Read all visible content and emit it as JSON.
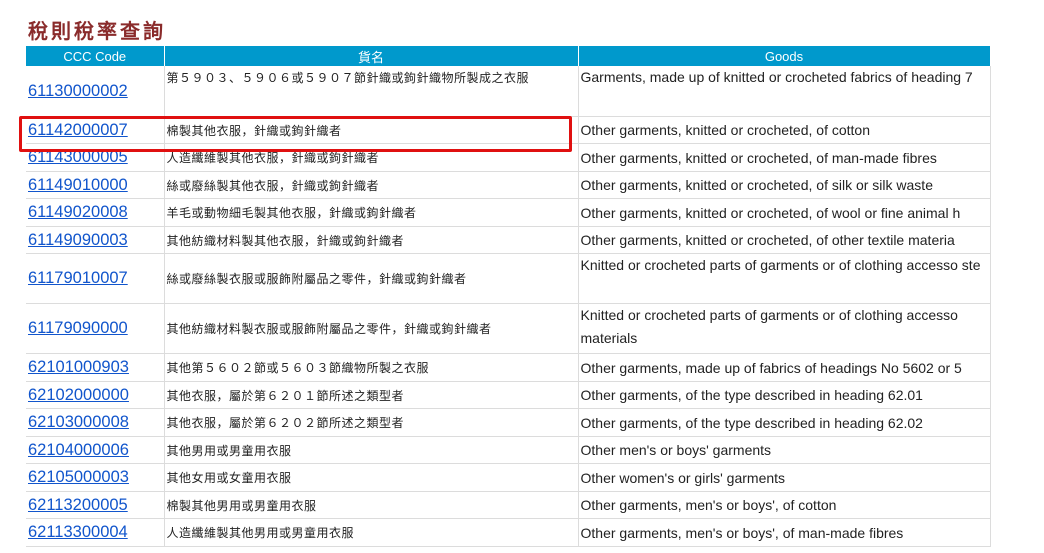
{
  "page": {
    "title": "稅則稅率查詢"
  },
  "table": {
    "headers": {
      "code": "CCC Code",
      "zh": "貨名",
      "en": "Goods"
    },
    "rows": [
      {
        "code": "61130000002",
        "zh": "第５９０３、５９０６或５９０７節針織或鉤針織物所製成之衣服",
        "en": "Garments, made up of knitted or crocheted fabrics of heading 7"
      },
      {
        "code": "61142000007",
        "zh": "棉製其他衣服，針織或鉤針織者",
        "en": "Other garments, knitted or crocheted, of cotton"
      },
      {
        "code": "61143000005",
        "zh": "人造纖維製其他衣服，針織或鉤針織者",
        "en": "Other garments, knitted or crocheted, of man-made fibres"
      },
      {
        "code": "61149010000",
        "zh": "絲或廢絲製其他衣服，針織或鉤針織者",
        "en": "Other garments, knitted or crocheted, of silk or silk waste"
      },
      {
        "code": "61149020008",
        "zh": "羊毛或動物細毛製其他衣服，針織或鉤針織者",
        "en": "Other garments, knitted or crocheted, of wool or fine animal h"
      },
      {
        "code": "61149090003",
        "zh": "其他紡織材料製其他衣服，針織或鉤針織者",
        "en": "Other garments, knitted or crocheted, of other textile materia"
      },
      {
        "code": "61179010007",
        "zh": "絲或廢絲製衣服或服飾附屬品之零件，針織或鉤針織者",
        "en": "Knitted or crocheted parts of garments or of clothing accesso ste"
      },
      {
        "code": "61179090000",
        "zh": "其他紡織材料製衣服或服飾附屬品之零件，針織或鉤針織者",
        "en": "Knitted or crocheted parts of garments or of clothing accesso materials"
      },
      {
        "code": "62101000903",
        "zh": "其他第５６０２節或５６０３節織物所製之衣服",
        "en": "Other garments, made up of fabrics of headings No 5602 or 5"
      },
      {
        "code": "62102000000",
        "zh": "其他衣服，屬於第６２０１節所述之類型者",
        "en": "Other garments, of the type described in heading 62.01"
      },
      {
        "code": "62103000008",
        "zh": "其他衣服，屬於第６２０２節所述之類型者",
        "en": "Other garments, of the type described in heading 62.02"
      },
      {
        "code": "62104000006",
        "zh": "其他男用或男童用衣服",
        "en": "Other men's or boys' garments"
      },
      {
        "code": "62105000003",
        "zh": "其他女用或女童用衣服",
        "en": "Other women's or girls' garments"
      },
      {
        "code": "62113200005",
        "zh": "棉製其他男用或男童用衣服",
        "en": "Other garments, men's or boys', of cotton"
      },
      {
        "code": "62113300004",
        "zh": "人造纖維製其他男用或男童用衣服",
        "en": "Other garments, men's or boys', of man-made fibres"
      }
    ]
  },
  "colors": {
    "header_bg": "#0099cc",
    "title": "#8a2b2b",
    "link": "#1155cc",
    "highlight": "#e01010"
  }
}
